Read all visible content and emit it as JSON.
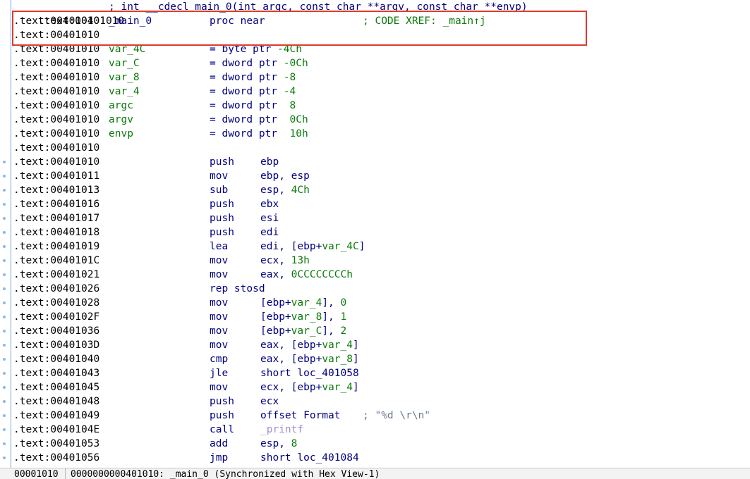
{
  "top_line": {
    "addr": ".text:00401010",
    "text": "; int __cdecl main_0(int argc, const char **argv, const char **envp)"
  },
  "lines": [
    {
      "addr": ".text:00401010",
      "label": "_main_0",
      "mnem": "proc near",
      "comment": "; CODE XREF: _main↑j",
      "kind": "proc"
    },
    {
      "addr": ".text:00401010",
      "kind": "blank"
    },
    {
      "addr": ".text:00401010",
      "label": "var_4C",
      "eq": "= byte ptr",
      "val": "-4Ch",
      "kind": "var"
    },
    {
      "addr": ".text:00401010",
      "label": "var_C",
      "eq": "= dword ptr",
      "val": "-0Ch",
      "kind": "var"
    },
    {
      "addr": ".text:00401010",
      "label": "var_8",
      "eq": "= dword ptr",
      "val": "-8",
      "kind": "var"
    },
    {
      "addr": ".text:00401010",
      "label": "var_4",
      "eq": "= dword ptr",
      "val": "-4",
      "kind": "var"
    },
    {
      "addr": ".text:00401010",
      "label": "argc",
      "eq": "= dword ptr",
      "val": " 8",
      "kind": "var"
    },
    {
      "addr": ".text:00401010",
      "label": "argv",
      "eq": "= dword ptr",
      "val": " 0Ch",
      "kind": "var"
    },
    {
      "addr": ".text:00401010",
      "label": "envp",
      "eq": "= dword ptr",
      "val": " 10h",
      "kind": "var"
    },
    {
      "addr": ".text:00401010",
      "kind": "blank"
    },
    {
      "addr": ".text:00401010",
      "mnem": "push",
      "ops": [
        {
          "t": "ebp"
        }
      ],
      "kind": "ins"
    },
    {
      "addr": ".text:00401011",
      "mnem": "mov",
      "ops": [
        {
          "t": "ebp, esp"
        }
      ],
      "kind": "ins"
    },
    {
      "addr": ".text:00401013",
      "mnem": "sub",
      "ops": [
        {
          "t": "esp, "
        },
        {
          "n": "4Ch"
        }
      ],
      "kind": "ins"
    },
    {
      "addr": ".text:00401016",
      "mnem": "push",
      "ops": [
        {
          "t": "ebx"
        }
      ],
      "kind": "ins"
    },
    {
      "addr": ".text:00401017",
      "mnem": "push",
      "ops": [
        {
          "t": "esi"
        }
      ],
      "kind": "ins"
    },
    {
      "addr": ".text:00401018",
      "mnem": "push",
      "ops": [
        {
          "t": "edi"
        }
      ],
      "kind": "ins"
    },
    {
      "addr": ".text:00401019",
      "mnem": "lea",
      "ops": [
        {
          "t": "edi, [ebp+"
        },
        {
          "v": "var_4C"
        },
        {
          "t": "]"
        }
      ],
      "kind": "ins"
    },
    {
      "addr": ".text:0040101C",
      "mnem": "mov",
      "ops": [
        {
          "t": "ecx, "
        },
        {
          "n": "13h"
        }
      ],
      "kind": "ins"
    },
    {
      "addr": ".text:00401021",
      "mnem": "mov",
      "ops": [
        {
          "t": "eax, "
        },
        {
          "n": "0CCCCCCCCh"
        }
      ],
      "kind": "ins"
    },
    {
      "addr": ".text:00401026",
      "mnem": "rep stosd",
      "ops": [],
      "kind": "ins"
    },
    {
      "addr": ".text:00401028",
      "mnem": "mov",
      "ops": [
        {
          "t": "[ebp+"
        },
        {
          "v": "var_4"
        },
        {
          "t": "], "
        },
        {
          "n": "0"
        }
      ],
      "kind": "ins"
    },
    {
      "addr": ".text:0040102F",
      "mnem": "mov",
      "ops": [
        {
          "t": "[ebp+"
        },
        {
          "v": "var_8"
        },
        {
          "t": "], "
        },
        {
          "n": "1"
        }
      ],
      "kind": "ins"
    },
    {
      "addr": ".text:00401036",
      "mnem": "mov",
      "ops": [
        {
          "t": "[ebp+"
        },
        {
          "v": "var_C"
        },
        {
          "t": "], "
        },
        {
          "n": "2"
        }
      ],
      "kind": "ins"
    },
    {
      "addr": ".text:0040103D",
      "mnem": "mov",
      "ops": [
        {
          "t": "eax, [ebp+"
        },
        {
          "v": "var_4"
        },
        {
          "t": "]"
        }
      ],
      "kind": "ins"
    },
    {
      "addr": ".text:00401040",
      "mnem": "cmp",
      "ops": [
        {
          "t": "eax, [ebp+"
        },
        {
          "v": "var_8"
        },
        {
          "t": "]"
        }
      ],
      "kind": "ins"
    },
    {
      "addr": ".text:00401043",
      "mnem": "jle",
      "ops": [
        {
          "t": "short loc_401058"
        }
      ],
      "kind": "ins"
    },
    {
      "addr": ".text:00401045",
      "mnem": "mov",
      "ops": [
        {
          "t": "ecx, [ebp+"
        },
        {
          "v": "var_4"
        },
        {
          "t": "]"
        }
      ],
      "kind": "ins"
    },
    {
      "addr": ".text:00401048",
      "mnem": "push",
      "ops": [
        {
          "t": "ecx"
        }
      ],
      "kind": "ins"
    },
    {
      "addr": ".text:00401049",
      "mnem": "push",
      "ops": [
        {
          "t": "offset Format"
        }
      ],
      "comment": "; \"%d \\r\\n\"",
      "kind": "ins"
    },
    {
      "addr": ".text:0040104E",
      "mnem": "call",
      "ops": [
        {
          "f": "_printf"
        }
      ],
      "kind": "ins"
    },
    {
      "addr": ".text:00401053",
      "mnem": "add",
      "ops": [
        {
          "t": "esp, "
        },
        {
          "n": "8"
        }
      ],
      "kind": "ins"
    },
    {
      "addr": ".text:00401056",
      "mnem": "jmp",
      "ops": [
        {
          "t": "short loc_401084"
        }
      ],
      "kind": "ins"
    }
  ],
  "statusbar": {
    "offset": "00001010",
    "address": "0000000000401010: _main_0 (Synchronized with Hex View-1)"
  },
  "colors": {
    "highlight_border": "#e03a2e",
    "label": "#0a7a0a",
    "mnemonic": "#000080",
    "comment": "#6b7a8f"
  }
}
